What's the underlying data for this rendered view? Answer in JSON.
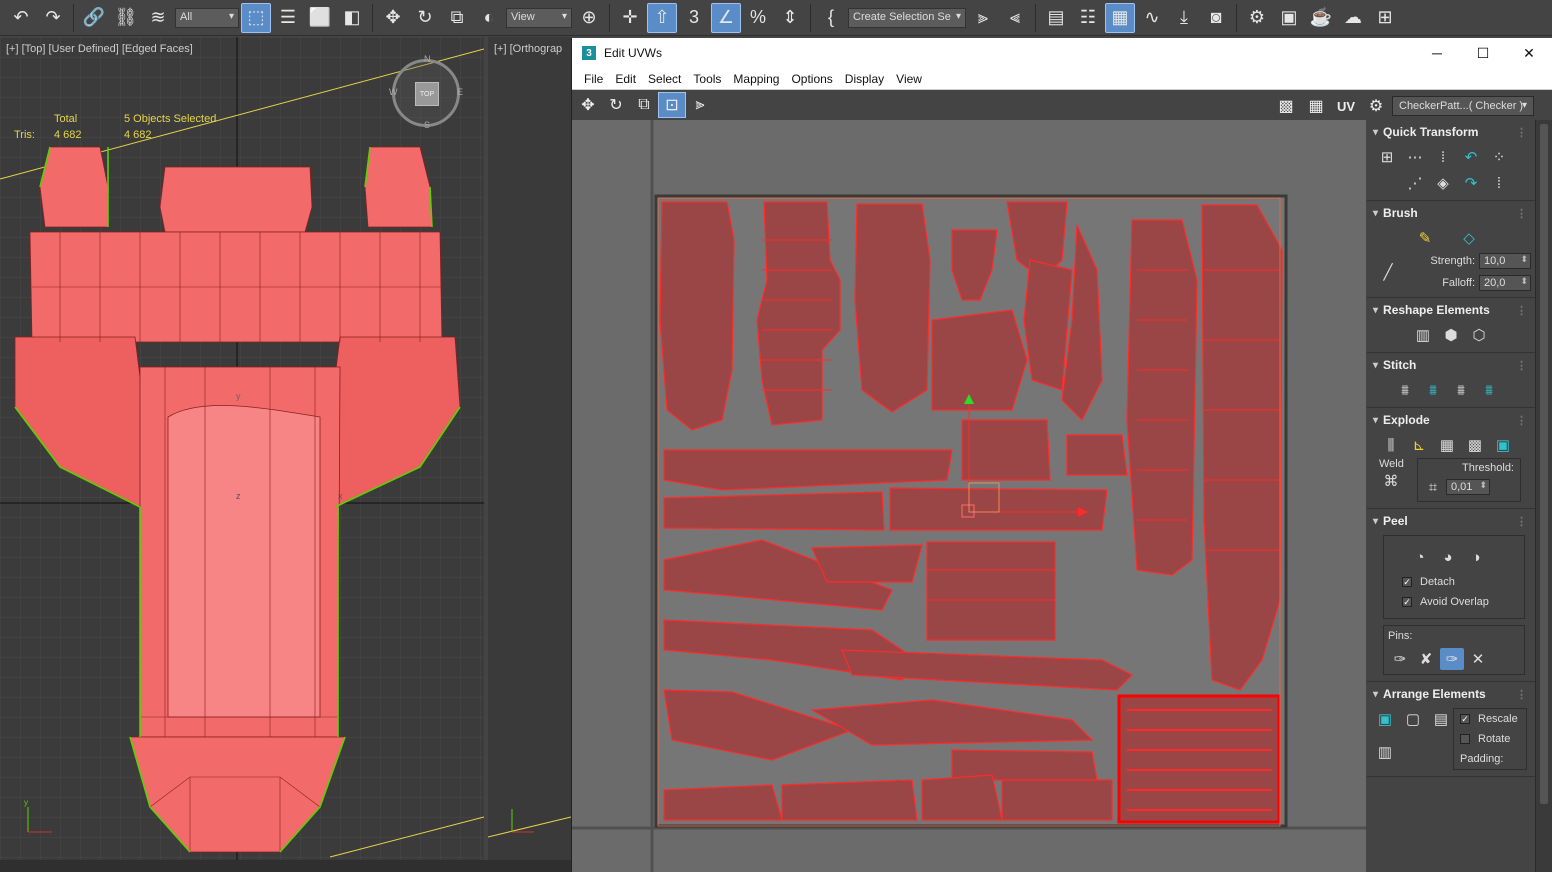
{
  "toolbar": {
    "selection_filter": "All",
    "reference_coord": "View",
    "named_selection": "Create Selection Se"
  },
  "left_viewport": {
    "label": "[+] [Top] [User Defined] [Edged Faces]",
    "stats": {
      "col_total": "Total",
      "col_selected": "5 Objects Selected",
      "row_label": "Tris:",
      "total_value": "4 682",
      "selected_value": "4 682"
    },
    "viewcube": {
      "top": "TOP",
      "n": "N",
      "s": "S",
      "e": "E",
      "w": "W"
    }
  },
  "middle_viewport": {
    "label": "[+] [Orthograp"
  },
  "uvw_window": {
    "title": "Edit UVWs",
    "app_icon": "3",
    "menu": [
      "File",
      "Edit",
      "Select",
      "Tools",
      "Mapping",
      "Options",
      "Display",
      "View"
    ],
    "uv_label": "UV",
    "texture_dropdown": "CheckerPatt...( Checker )"
  },
  "panel": {
    "quick_transform": {
      "title": "Quick Transform"
    },
    "brush": {
      "title": "Brush",
      "strength_label": "Strength:",
      "strength_value": "10,0",
      "falloff_label": "Falloff:",
      "falloff_value": "20,0"
    },
    "reshape": {
      "title": "Reshape Elements"
    },
    "stitch": {
      "title": "Stitch"
    },
    "explode": {
      "title": "Explode",
      "weld_label": "Weld",
      "threshold_label": "Threshold:",
      "threshold_value": "0,01"
    },
    "peel": {
      "title": "Peel",
      "detach_label": "Detach",
      "avoid_overlap_label": "Avoid Overlap",
      "pins_label": "Pins:"
    },
    "arrange": {
      "title": "Arrange Elements",
      "rescale_label": "Rescale",
      "rotate_label": "Rotate",
      "padding_label": "Padding:"
    }
  },
  "colors": {
    "selection_red": "#ff3b3b",
    "mesh_fill": "#f26a6a",
    "edge_green": "#5cd000",
    "stats_yellow": "#e5d44a",
    "accent_blue": "#5a8cc8",
    "teal_icon": "#2fc3cf"
  }
}
